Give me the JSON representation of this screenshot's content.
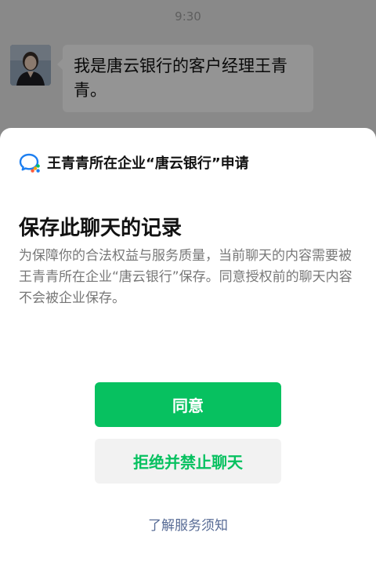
{
  "status": {
    "time": "9:30"
  },
  "chat": {
    "message": "我是唐云银行的客户经理王青青。"
  },
  "sheet": {
    "header": "王青青所在企业“唐云银行”申请",
    "title": "保存此聊天的记录",
    "description": "为保障你的合法权益与服务质量，当前聊天的内容需要被王青青所在企业“唐云银行”保存。同意授权前的聊天内容不会被企业保存。",
    "agree_label": "同意",
    "reject_label": "拒绝并禁止聊天",
    "terms_link": "了解服务须知"
  },
  "colors": {
    "accent": "#07c160",
    "link": "#576b95",
    "brand_blue": "#1d7ff1"
  },
  "icons": {
    "brand": "wecom-logo-icon",
    "avatar": "avatar"
  }
}
